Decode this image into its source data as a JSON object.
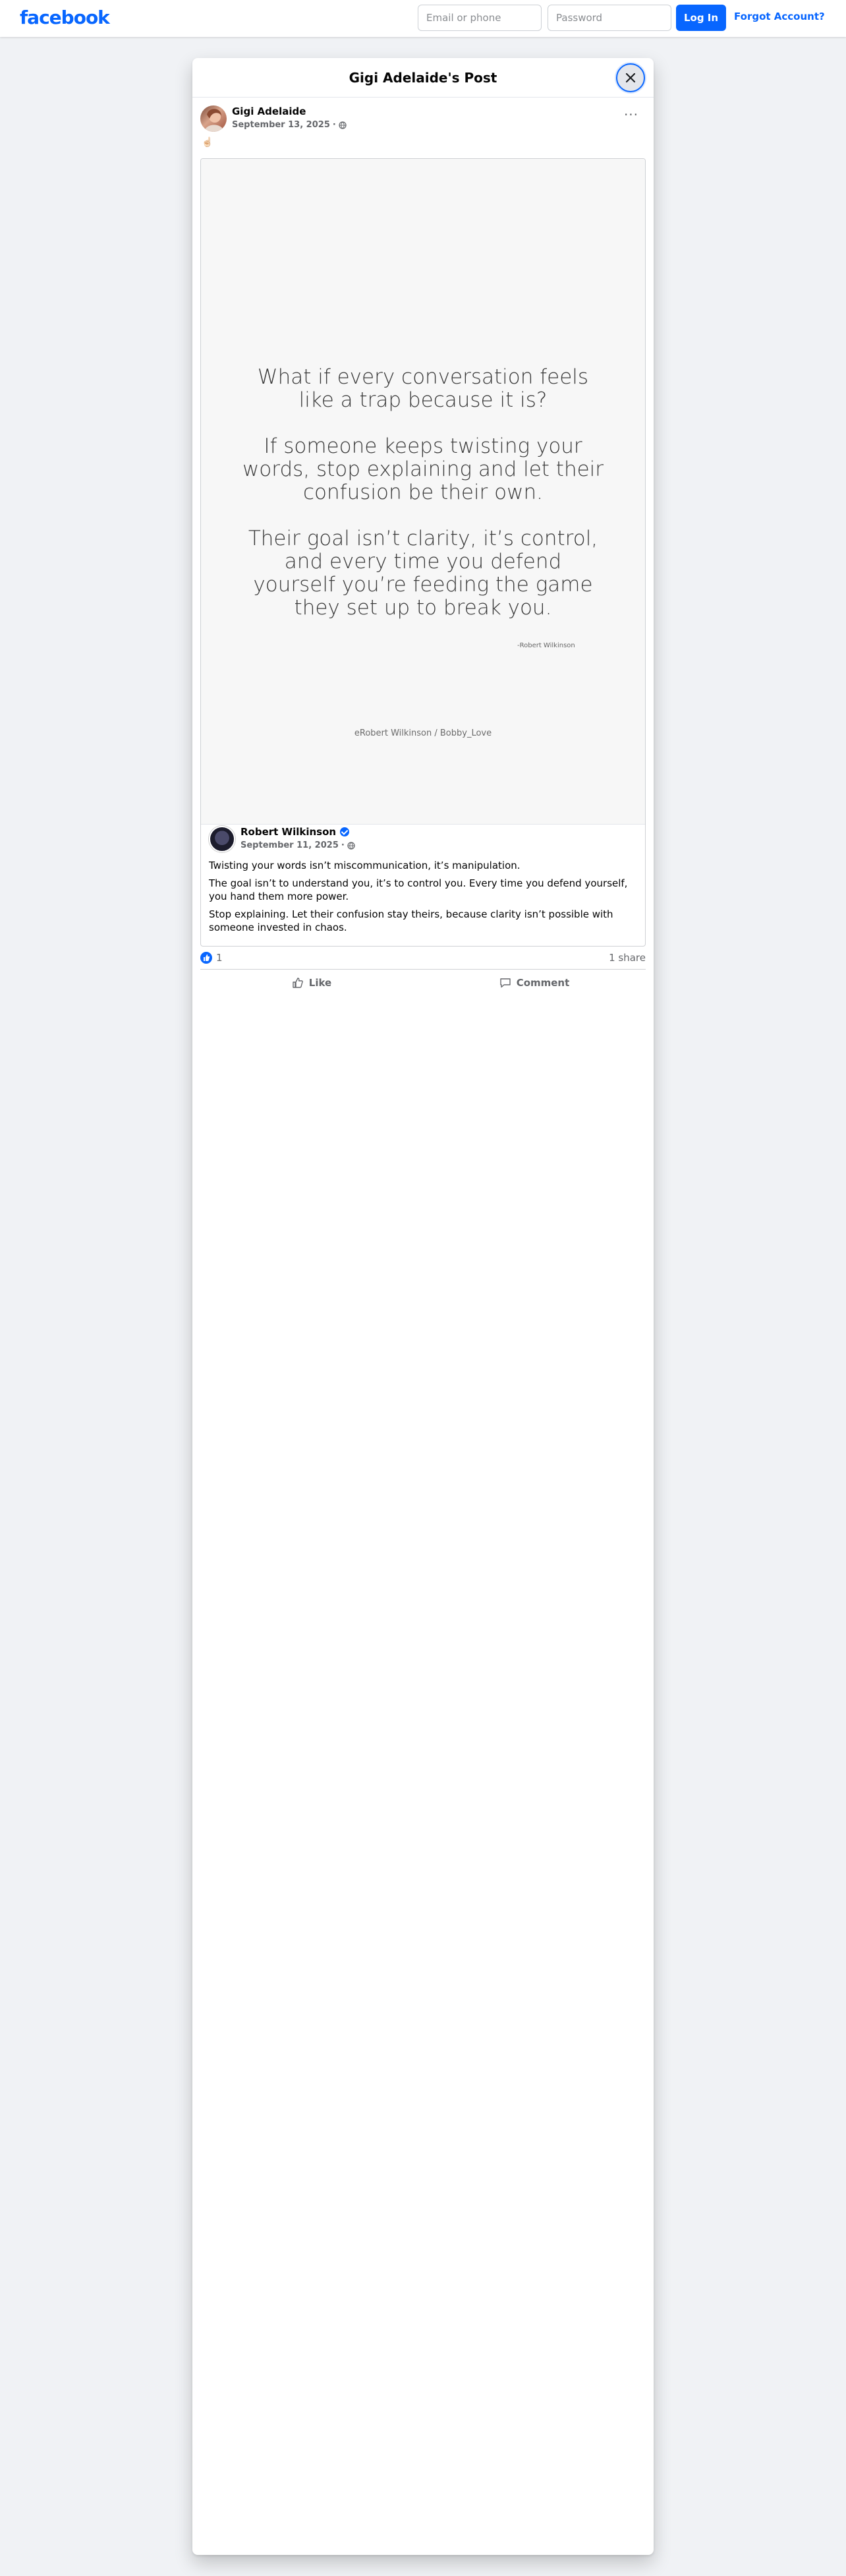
{
  "header": {
    "logo": "facebook",
    "email_placeholder": "Email or phone",
    "password_placeholder": "Password",
    "login_label": "Log In",
    "forgot_label": "Forgot Account?"
  },
  "modal": {
    "title": "Gigi Adelaide's Post"
  },
  "post": {
    "author": "Gigi Adelaide",
    "date": "September 13, 2025",
    "separator": "·",
    "more_label": "···",
    "emoji": "☝🏻",
    "reaction_count": "1",
    "shares": "1 share",
    "like_label": "Like",
    "comment_label": "Comment"
  },
  "shared": {
    "quote_paragraphs": [
      "What if every conversation feels like a trap because it is?",
      "If someone keeps twisting your words, stop explaining and let their confusion be their own.",
      "Their goal isn’t clarity, it’s control, and every time you defend yourself you’re feeding the game they set up to break you."
    ],
    "quote_author": "-Robert Wilkinson",
    "watermark": "eRobert Wilkinson / Bobby_Love",
    "author": "Robert Wilkinson",
    "date": "September 11, 2025",
    "separator": "·",
    "body": [
      "Twisting your words isn’t miscommunication, it’s manipulation.",
      "The goal isn’t to understand you, it’s to control you. Every time you defend yourself, you hand them more power.",
      "Stop explaining. Let their confusion stay theirs, because clarity isn’t possible with someone invested in chaos."
    ]
  },
  "colors": {
    "brand": "#0866ff",
    "background": "#f0f2f5",
    "secondary_text": "#65676b"
  }
}
